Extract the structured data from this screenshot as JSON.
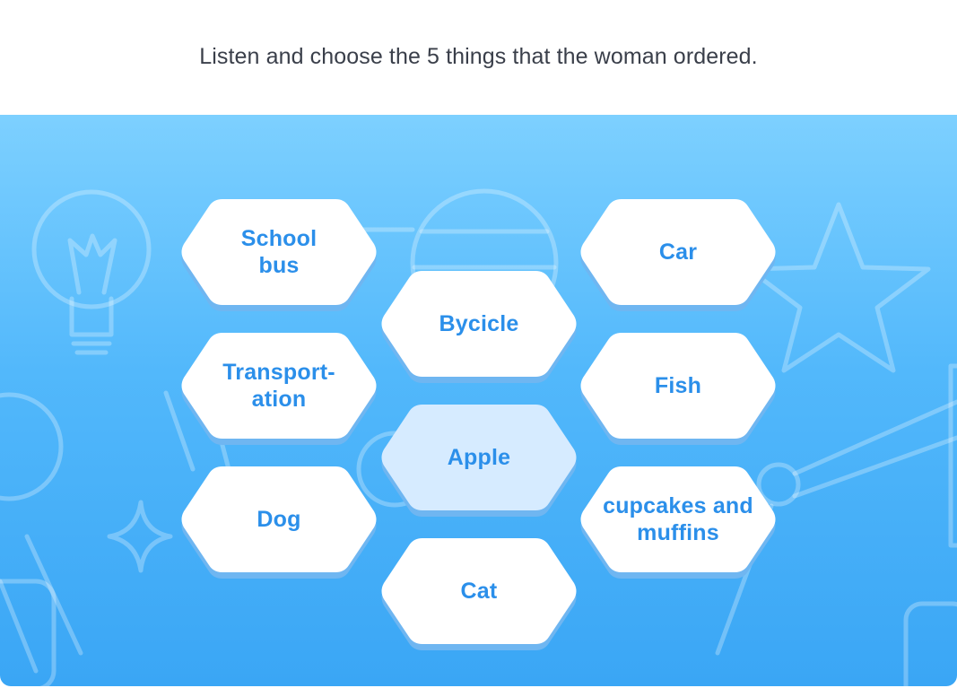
{
  "instruction": "Listen and choose the 5 things that the woman ordered.",
  "colors": {
    "board_top": "#7dd0ff",
    "board_bottom": "#3aa6f5",
    "option_fill": "#ffffff",
    "option_selected_fill": "#d6ebff",
    "option_shadow": "#6fb6f1",
    "option_text": "#2b8fea"
  },
  "background_icons": [
    "lightbulb-icon",
    "globe-icon",
    "star-icon",
    "magnifier-icon",
    "sparkle-icon",
    "desk-lamp-icon"
  ],
  "options": [
    {
      "id": "school-bus",
      "label": "School\nbus",
      "selected": false
    },
    {
      "id": "car",
      "label": "Car",
      "selected": false
    },
    {
      "id": "bycicle",
      "label": "Bycicle",
      "selected": false
    },
    {
      "id": "transportation",
      "label": "Transport-\nation",
      "selected": false
    },
    {
      "id": "fish",
      "label": "Fish",
      "selected": false
    },
    {
      "id": "apple",
      "label": "Apple",
      "selected": true
    },
    {
      "id": "dog",
      "label": "Dog",
      "selected": false
    },
    {
      "id": "cupcakes-and-muffins",
      "label": "cupcakes and\nmuffins",
      "selected": false
    },
    {
      "id": "cat",
      "label": "Cat",
      "selected": false
    }
  ]
}
